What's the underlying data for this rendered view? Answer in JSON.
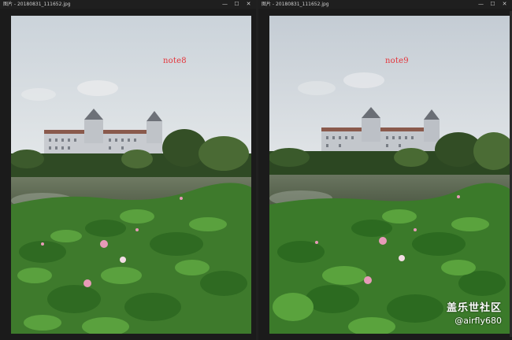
{
  "windows": [
    {
      "title": "图片 - 20180831_111652.jpg",
      "controls": {
        "minimize": "—",
        "maximize": "☐",
        "close": "✕"
      },
      "note": "note8"
    },
    {
      "title": "图片 - 20180831_111652.jpg",
      "controls": {
        "minimize": "—",
        "maximize": "☐",
        "close": "✕"
      },
      "note": "note9"
    }
  ],
  "watermark": {
    "title": "盖乐世社区",
    "user": "@airfly680"
  },
  "colors": {
    "note": "#e4343a",
    "sky": "#c9d3dc",
    "foliage": "#3d7a2e",
    "water": "#5f6d55"
  }
}
